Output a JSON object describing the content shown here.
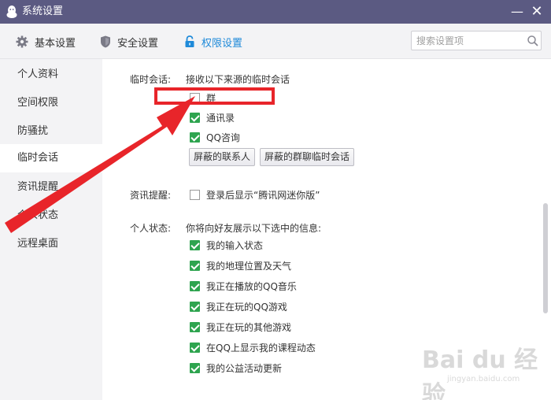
{
  "window": {
    "title": "系统设置",
    "min": "—",
    "close": "✕"
  },
  "tabs": [
    {
      "label": "基本设置",
      "icon": "gear-icon"
    },
    {
      "label": "安全设置",
      "icon": "shield-icon"
    },
    {
      "label": "权限设置",
      "icon": "lock-icon",
      "active": true
    }
  ],
  "search": {
    "placeholder": "搜索设置项"
  },
  "sidebar": {
    "items": [
      {
        "label": "个人资料"
      },
      {
        "label": "空间权限"
      },
      {
        "label": "防骚扰"
      },
      {
        "label": "临时会话",
        "active": true
      },
      {
        "label": "资讯提醒"
      },
      {
        "label": "个人状态"
      },
      {
        "label": "远程桌面"
      }
    ]
  },
  "temp_session": {
    "label": "临时会话:",
    "desc": "接收以下来源的临时会话",
    "options": [
      {
        "label": "群",
        "checked": false
      },
      {
        "label": "通讯录",
        "checked": true
      },
      {
        "label": "QQ咨询",
        "checked": true
      }
    ],
    "buttons": [
      "屏蔽的联系人",
      "屏蔽的群聊临时会话"
    ]
  },
  "news_reminder": {
    "label": "资讯提醒:",
    "option": {
      "label": "登录后显示“腾讯网迷你版”",
      "checked": false
    }
  },
  "personal_status": {
    "label": "个人状态:",
    "desc": "你将向好友展示以下选中的信息:",
    "options": [
      {
        "label": "我的输入状态",
        "checked": true
      },
      {
        "label": "我的地理位置及天气",
        "checked": true
      },
      {
        "label": "我正在播放的QQ音乐",
        "checked": true
      },
      {
        "label": "我正在玩的QQ游戏",
        "checked": true
      },
      {
        "label": "我正在玩的其他游戏",
        "checked": true
      },
      {
        "label": "在QQ上显示我的课程动态",
        "checked": true
      },
      {
        "label": "我的公益活动更新",
        "checked": true
      }
    ]
  },
  "watermark": {
    "text": "Bai du 经验",
    "sub": "jingyan.baidu.com"
  },
  "colors": {
    "titlebar": "#5b5a82",
    "accent": "#1f8ad9",
    "check": "#2ea44f",
    "annotation": "#e8252a"
  }
}
